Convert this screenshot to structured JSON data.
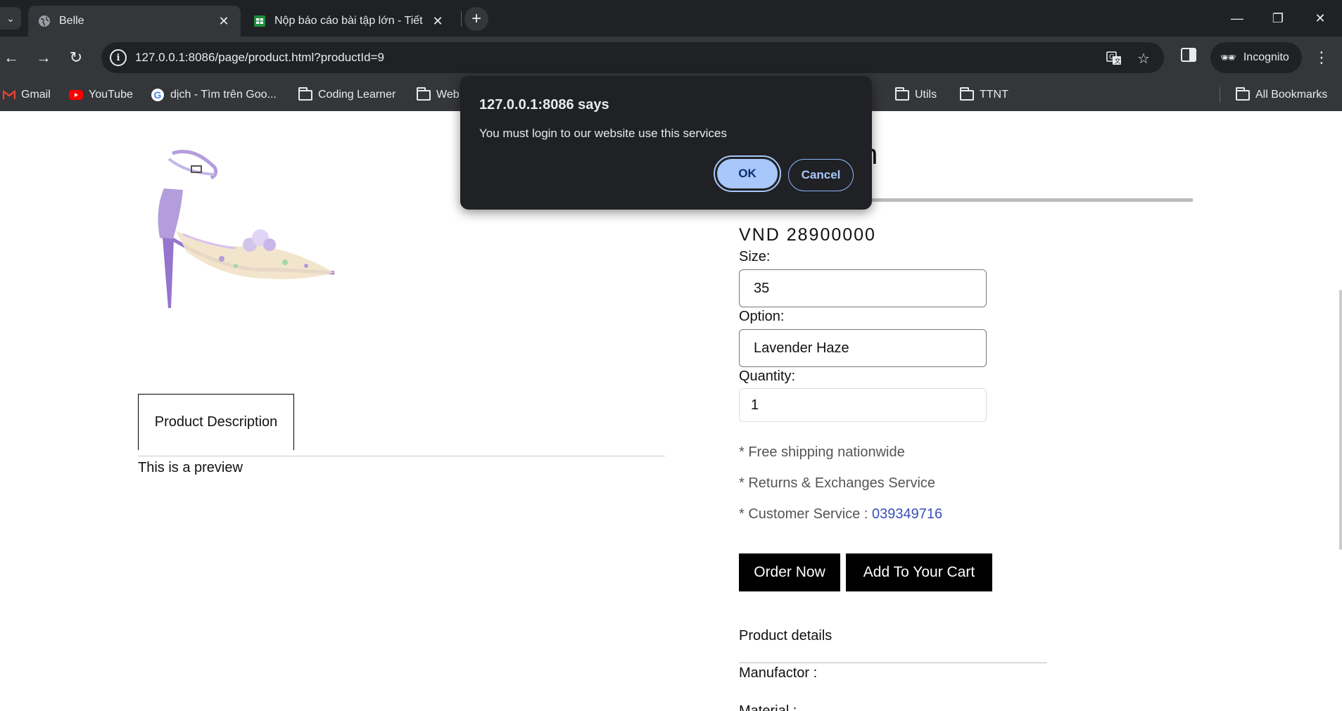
{
  "browser": {
    "tabs": [
      {
        "title": "Belle",
        "favicon": "globe-icon",
        "active": true
      },
      {
        "title": "Nộp báo cáo bài tập lớn - Tiết",
        "favicon": "google-sheets-icon",
        "active": false
      }
    ],
    "url": "127.0.0.1:8086/page/product.html?productId=9",
    "incognito_label": "Incognito",
    "bookmarks": [
      {
        "label": "Gmail",
        "icon": "gmail-icon"
      },
      {
        "label": "YouTube",
        "icon": "youtube-icon"
      },
      {
        "label": "dịch - Tìm trên Goo...",
        "icon": "google-icon"
      },
      {
        "label": "Coding Learner",
        "icon": "folder-icon"
      },
      {
        "label": "Web",
        "icon": "folder-icon"
      },
      {
        "label": "Utils",
        "icon": "folder-icon"
      },
      {
        "label": "TTNT",
        "icon": "folder-icon"
      }
    ],
    "all_bookmarks": "All Bookmarks"
  },
  "dialog": {
    "title": "127.0.0.1:8086 says",
    "message": "You must login to our website use this services",
    "ok_label": "OK",
    "cancel_label": "Cancel"
  },
  "product": {
    "title_fragment": "n",
    "price": "VND 28900000",
    "size_label": "Size:",
    "size_value": "35",
    "option_label": "Option:",
    "option_value": "Lavender Haze",
    "quantity_label": "Quantity:",
    "quantity_value": "1",
    "features": [
      "* Free shipping nationwide",
      "* Returns & Exchanges Service"
    ],
    "customer_service_label": "* Customer Service : ",
    "customer_service_phone": "039349716",
    "order_button": "Order Now",
    "cart_button": "Add To Your Cart",
    "details_title": "Product details",
    "manufactor_label": "Manufactor :",
    "material_label": "Material :",
    "description_tab": "Product Description",
    "description_text": "This is a preview"
  },
  "colors": {
    "chrome_dark": "#202124",
    "chrome_mid": "#35363a",
    "dialog_ok": "#a8c7fa",
    "phone_link": "#3a4fb8",
    "shoe_lavender": "#b39ddb"
  }
}
